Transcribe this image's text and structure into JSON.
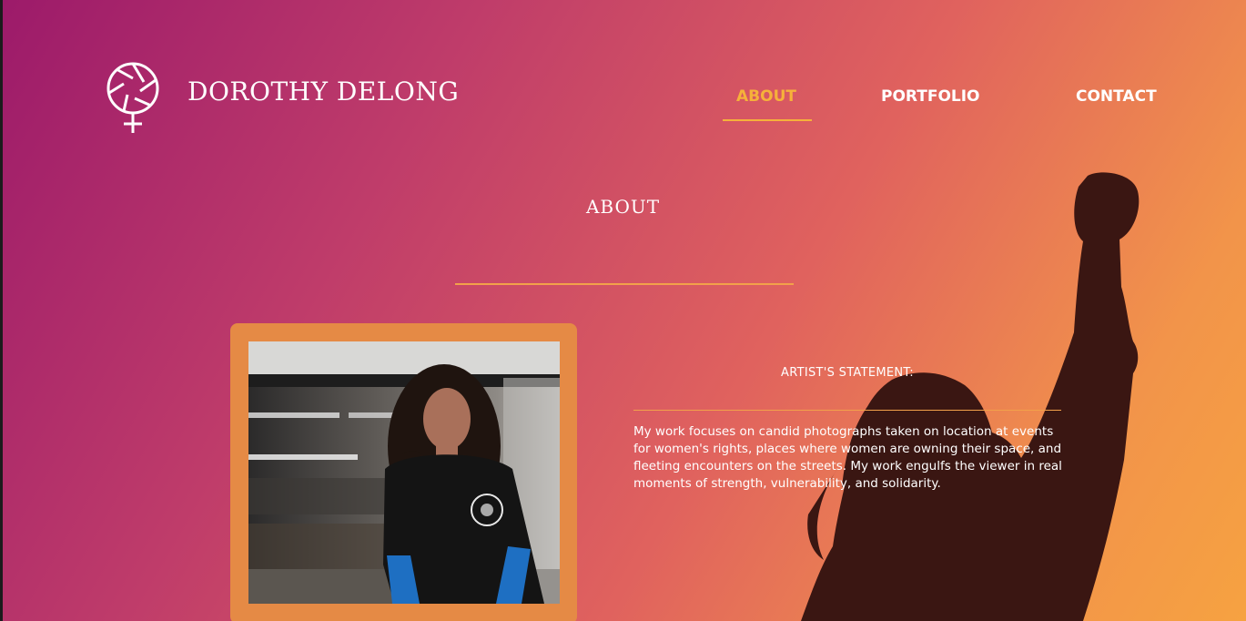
{
  "header": {
    "brand_name": "DOROTHY DELONG",
    "logo_icon": "aperture-venus-icon"
  },
  "nav": {
    "items": [
      {
        "label": "ABOUT",
        "active": true
      },
      {
        "label": "PORTFOLIO",
        "active": false
      },
      {
        "label": "CONTACT",
        "active": false
      }
    ]
  },
  "main": {
    "title": "ABOUT",
    "statement_heading": "ARTIST'S STATEMENT:",
    "statement_body": "My work focuses on candid photographs taken on location at events for women's rights, places where women are owning their space, and fleeting encounters on the streets. My work engulfs the viewer in real moments of strength, vulnerability, and solidarity."
  },
  "colors": {
    "accent": "#f6b13a",
    "frame": "#e58a45",
    "gradient_start": "#9c1a6a",
    "gradient_end": "#f6a241"
  }
}
